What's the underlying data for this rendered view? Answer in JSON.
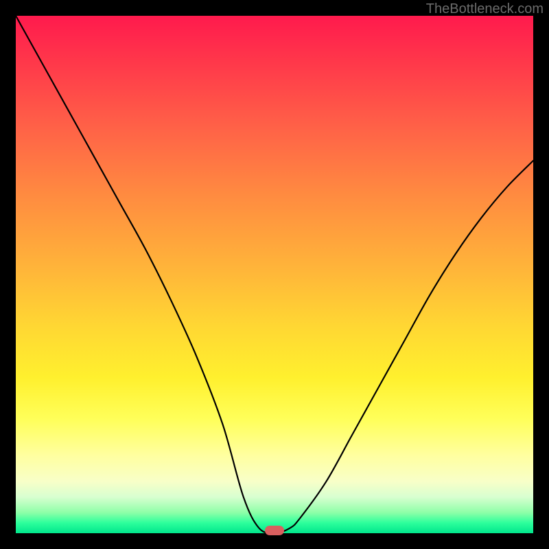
{
  "watermark": "TheBottleneck.com",
  "chart_data": {
    "type": "line",
    "title": "",
    "xlabel": "",
    "ylabel": "",
    "xlim": [
      0,
      100
    ],
    "ylim": [
      0,
      100
    ],
    "grid": false,
    "legend": false,
    "series": [
      {
        "name": "bottleneck-curve",
        "x": [
          0,
          5,
          10,
          15,
          20,
          25,
          30,
          35,
          40,
          44,
          47,
          50,
          53,
          55,
          60,
          65,
          70,
          75,
          80,
          85,
          90,
          95,
          100
        ],
        "values": [
          100,
          91,
          82,
          73,
          64,
          55,
          45,
          34,
          21,
          7,
          1,
          0,
          1,
          3,
          10,
          19,
          28,
          37,
          46,
          54,
          61,
          67,
          72
        ]
      }
    ],
    "marker": {
      "x": 50,
      "y": 0
    },
    "background": "heatmap-gradient-red-to-green"
  }
}
